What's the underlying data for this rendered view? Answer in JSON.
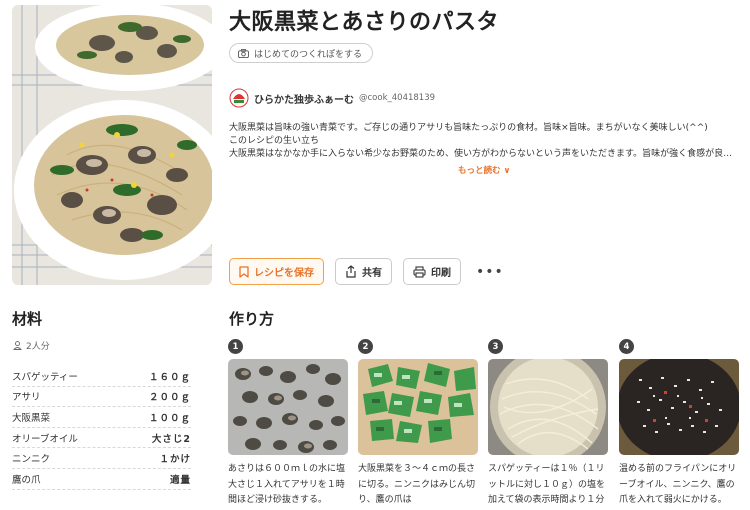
{
  "recipe": {
    "title": "大阪黒菜とあさりのパスタ",
    "first_button": "はじめてのつくれぽをする",
    "author_name": "ひらかた独歩ふぁーむ",
    "author_id": "@cook_40418139",
    "desc_lines": [
      "大阪黒菜は旨味の強い青菜です。ご存じの通りアサリも旨味たっぷりの食材。旨味×旨味。まちがいなく美味しい(^^)",
      "このレシピの生い立ち",
      "大阪黒菜はなかなか手に入らない希少なお野菜のため、使い方がわからないという声をいただきます。旨味が強く食感が良い、大阪黒菜ならで..."
    ],
    "more_label": "もっと読む ∨"
  },
  "actions": {
    "save": "レシピを保存",
    "share": "共有",
    "print": "印刷",
    "more": "•••"
  },
  "ingredients": {
    "heading": "材料",
    "servings": "2人分",
    "items": [
      {
        "name": "スパゲッティー",
        "qty": "１６０ｇ"
      },
      {
        "name": "アサリ",
        "qty": "２００ｇ"
      },
      {
        "name": "大阪黒菜",
        "qty": "１００ｇ"
      },
      {
        "name": "オリーブオイル",
        "qty": "大さじ2"
      },
      {
        "name": "ニンニク",
        "qty": "１かけ"
      },
      {
        "name": "鷹の爪",
        "qty": "適量"
      }
    ]
  },
  "steps": {
    "heading": "作り方",
    "items": [
      {
        "num": "1",
        "text": "あさりは６００ｍｌの水に塩大さじ１入れてアサリを１時間ほど浸け砂抜きする。"
      },
      {
        "num": "2",
        "text": "大阪黒菜を３～４ｃｍの長さに切る。ニンニクはみじん切り、鷹の爪は"
      },
      {
        "num": "3",
        "text": "スパゲッティーは１％（１リットルに対し１０ｇ）の塩を加えて袋の表示時間より１分ほど"
      },
      {
        "num": "4",
        "text": "温める前のフライパンにオリーブオイル、ニンニク、鷹の爪を入れて弱火にかける。"
      }
    ]
  },
  "colors": {
    "accent_orange": "#e8732a",
    "text_dark": "#222222",
    "step_badge": "#444444"
  }
}
